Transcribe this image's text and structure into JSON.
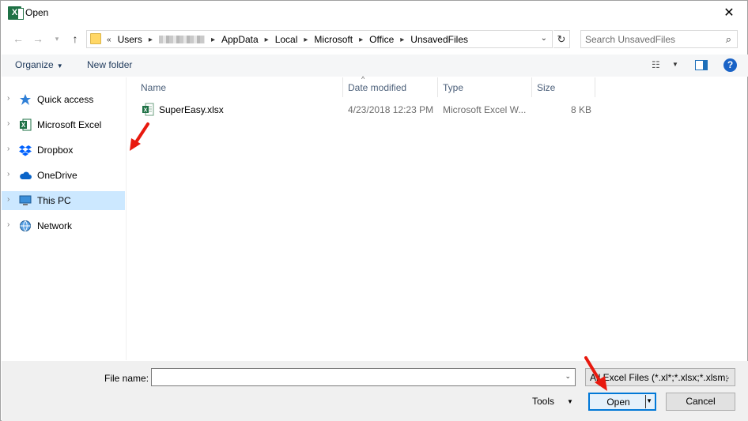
{
  "window": {
    "title": "Open",
    "app_icon_letter": "X"
  },
  "address": {
    "overflow": "«",
    "crumbs": [
      "Users",
      "AppData",
      "Local",
      "Microsoft",
      "Office",
      "UnsavedFiles"
    ],
    "search_placeholder": "Search UnsavedFiles"
  },
  "toolbar": {
    "organize_label": "Organize",
    "new_folder_label": "New folder",
    "help_label": "?"
  },
  "sidebar": {
    "items": [
      {
        "label": "Quick access",
        "icon": "star-icon"
      },
      {
        "label": "Microsoft Excel",
        "icon": "excel-icon"
      },
      {
        "label": "Dropbox",
        "icon": "dropbox-icon"
      },
      {
        "label": "OneDrive",
        "icon": "cloud-icon"
      },
      {
        "label": "This PC",
        "icon": "computer-icon",
        "selected": true
      },
      {
        "label": "Network",
        "icon": "network-icon"
      }
    ]
  },
  "filelist": {
    "columns": [
      "Name",
      "Date modified",
      "Type",
      "Size"
    ],
    "files": [
      {
        "name": "SuperEasy.xlsx",
        "date": "4/23/2018 12:23 PM",
        "type": "Microsoft Excel W...",
        "size": "8 KB"
      }
    ]
  },
  "bottom": {
    "filename_label": "File name:",
    "filename_value": "",
    "filter_value": "All Excel Files (*.xl*;*.xlsx;*.xlsm;",
    "tools_label": "Tools",
    "open_label": "Open",
    "cancel_label": "Cancel"
  },
  "colors": {
    "accent": "#0078d7",
    "selected_bg": "#cce8ff",
    "excel_green": "#1e7145",
    "annotation_red": "#e8190e"
  }
}
